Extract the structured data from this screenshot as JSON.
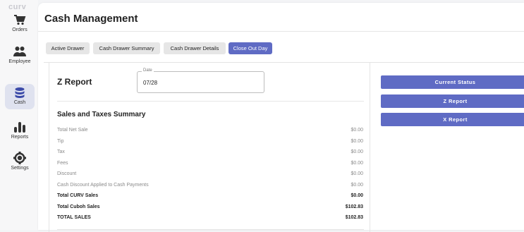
{
  "brand": "curv",
  "sidebar": {
    "items": [
      {
        "label": "Orders",
        "icon": "cart-icon"
      },
      {
        "label": "Employee",
        "icon": "people-icon"
      },
      {
        "label": "Cash",
        "icon": "database-icon"
      },
      {
        "label": "Reports",
        "icon": "bar-chart-icon"
      },
      {
        "label": "Settings",
        "icon": "gear-icon"
      }
    ],
    "active": "Cash"
  },
  "header": {
    "title": "Cash Management"
  },
  "tabs": [
    {
      "label": "Active Drawer"
    },
    {
      "label": "Cash Drawer Summary"
    },
    {
      "label": "Cash Drawer Details"
    },
    {
      "label": "Close Out Day"
    }
  ],
  "active_tab": "Close Out Day",
  "report": {
    "title": "Z Report",
    "date_label": "Date",
    "date_value": "07/28",
    "section_title": "Sales and Taxes Summary",
    "rows": [
      {
        "label": "Total Net Sale",
        "value": "$0.00"
      },
      {
        "label": "Tip",
        "value": "$0.00"
      },
      {
        "label": "Tax",
        "value": "$0.00"
      },
      {
        "label": "Fees",
        "value": "$0.00"
      },
      {
        "label": "Discount",
        "value": "$0.00"
      },
      {
        "label": "Cash Discount Applied to Cash Payments",
        "value": "$0.00"
      },
      {
        "label": "Total CURV Sales",
        "value": "$0.00"
      },
      {
        "label": "Total Cuboh Sales",
        "value": "$102.83"
      },
      {
        "label": "TOTAL SALES",
        "value": "$102.83"
      }
    ]
  },
  "actions": [
    {
      "label": "Current Status"
    },
    {
      "label": "Z Report"
    },
    {
      "label": "X Report"
    }
  ],
  "colors": {
    "accent": "#5f6bc4",
    "active_nav_bg": "#dfe2ef",
    "tab_bg": "#e6e6e6"
  }
}
